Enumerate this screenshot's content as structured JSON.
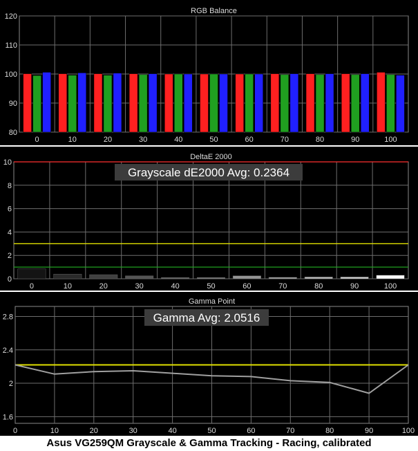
{
  "caption": "Asus VG259QM Grayscale & Gamma Tracking - Racing, calibrated",
  "chart_data": [
    {
      "type": "bar",
      "title": "RGB Balance",
      "categories": [
        "0",
        "10",
        "20",
        "30",
        "40",
        "50",
        "60",
        "70",
        "80",
        "90",
        "100"
      ],
      "ylim": [
        80,
        120
      ],
      "yticks": [
        80,
        90,
        100,
        110,
        120
      ],
      "grid": true,
      "series": [
        {
          "color": "#ff2020",
          "values": [
            100.1,
            100.1,
            100.1,
            100.1,
            100.0,
            100.0,
            100.0,
            100.1,
            100.1,
            100.1,
            100.6
          ]
        },
        {
          "color": "#20a020",
          "values": [
            99.5,
            99.6,
            99.6,
            99.8,
            100.0,
            100.0,
            100.0,
            99.8,
            99.8,
            99.8,
            99.8
          ]
        },
        {
          "color": "#2020ff",
          "values": [
            100.6,
            100.4,
            100.3,
            100.1,
            100.0,
            100.0,
            100.0,
            100.1,
            100.1,
            100.1,
            99.6
          ]
        }
      ]
    },
    {
      "type": "bar",
      "title": "DeltaE 2000",
      "annotation": "Grayscale dE2000 Avg: 0.2364",
      "categories": [
        "0",
        "10",
        "20",
        "30",
        "40",
        "50",
        "60",
        "70",
        "80",
        "90",
        "100"
      ],
      "ylim": [
        0,
        10
      ],
      "yticks": [
        0,
        2,
        4,
        6,
        8,
        10
      ],
      "grid": true,
      "values": [
        0.85,
        0.4,
        0.35,
        0.25,
        0.1,
        0.1,
        0.25,
        0.12,
        0.15,
        0.15,
        0.3
      ],
      "bar_colors": [
        "#141414",
        "#2a2a2a",
        "#404040",
        "#555555",
        "#6a6a6a",
        "#808080",
        "#959595",
        "#aaaaaa",
        "#c0c0c0",
        "#d5d5d5",
        "#ffffff"
      ],
      "reference_lines": [
        {
          "value": 10,
          "color": "#ff3030"
        },
        {
          "value": 3,
          "color": "#e0e000"
        },
        {
          "value": 1,
          "color": "#20a020"
        }
      ]
    },
    {
      "type": "line",
      "title": "Gamma Point",
      "annotation": "Gamma Avg: 2.0516",
      "x": [
        0,
        10,
        20,
        30,
        40,
        50,
        60,
        70,
        80,
        90,
        100
      ],
      "y": [
        2.22,
        2.11,
        2.14,
        2.15,
        2.12,
        2.09,
        2.08,
        2.03,
        2.01,
        1.88,
        2.22
      ],
      "xlim": [
        0,
        100
      ],
      "xticks": [
        0,
        10,
        20,
        30,
        40,
        50,
        60,
        70,
        80,
        90,
        100
      ],
      "ylim": [
        1.52,
        2.92
      ],
      "yticks": [
        1.6,
        2.0,
        2.4,
        2.8
      ],
      "ytick_labels": [
        "1.6",
        "2",
        "2.4",
        "2.8"
      ],
      "grid": true,
      "line_color": "#a0a0a0",
      "reference_lines": [
        {
          "value": 2.22,
          "color": "#e0e000"
        }
      ]
    }
  ]
}
